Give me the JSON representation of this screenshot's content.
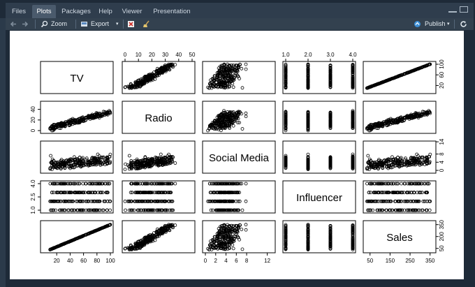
{
  "tabs": [
    {
      "label": "Files",
      "active": false
    },
    {
      "label": "Plots",
      "active": true
    },
    {
      "label": "Packages",
      "active": false
    },
    {
      "label": "Help",
      "active": false
    },
    {
      "label": "Viewer",
      "active": false
    },
    {
      "label": "Presentation",
      "active": false
    }
  ],
  "toolbar": {
    "zoom_label": "Zoom",
    "export_label": "Export",
    "publish_label": "Publish"
  },
  "icons": {
    "back": "back-arrow-icon",
    "forward": "forward-arrow-icon",
    "zoom": "magnifier-icon",
    "export": "export-icon",
    "remove": "remove-plot-icon",
    "clear": "broom-icon",
    "publish": "publish-icon",
    "refresh": "refresh-icon"
  },
  "colors": {
    "frame_bg": "#1e2a38",
    "tab_active": "#4a5a6c",
    "publish_accent": "#3b8ed6"
  },
  "chart_data": {
    "type": "scatter",
    "variables": [
      "TV",
      "Radio",
      "Social Media",
      "Influencer",
      "Sales"
    ],
    "axis_ticks": {
      "TV": [
        "20",
        "40",
        "60",
        "80",
        "100"
      ],
      "Radio": [
        "0",
        "10",
        "20",
        "30",
        "40",
        "50"
      ],
      "Social Media": [
        "0",
        "2",
        "4",
        "6",
        "8",
        "12"
      ],
      "Influencer": [
        "1.0",
        "2.0",
        "3.0",
        "4.0",
        "1.0",
        "2.5",
        "4.0"
      ],
      "Sales": [
        "50",
        "150",
        "250",
        "350",
        "50",
        "200",
        "350"
      ]
    },
    "top_axis_labels": {
      "Radio": [
        "0",
        "10",
        "20",
        "30",
        "40",
        "50"
      ],
      "Influencer": [
        "1.0",
        "2.0",
        "3.0",
        "4.0"
      ]
    },
    "right_axis_labels": {
      "TV": [
        "20",
        "60",
        "100"
      ],
      "Social Media": [
        "0",
        "4",
        "8",
        "14"
      ],
      "Sales": [
        "50",
        "200",
        "350"
      ]
    },
    "left_axis_labels": {
      "Radio": [
        "0",
        "20",
        "40"
      ],
      "Influencer": [
        "1.0",
        "2.5",
        "4.0"
      ]
    },
    "bottom_axis_labels": {
      "TV": [
        "20",
        "40",
        "60",
        "80",
        "100"
      ],
      "Social Media": [
        "0",
        "2",
        "4",
        "6",
        "8",
        "12"
      ],
      "Sales": [
        "50",
        "150",
        "250",
        "350"
      ]
    },
    "xlim": {
      "TV": [
        0,
        100
      ],
      "Radio": [
        0,
        50
      ],
      "Social Media": [
        0,
        13
      ],
      "Influencer": [
        1,
        4
      ],
      "Sales": [
        30,
        365
      ]
    },
    "grid": false,
    "legend": "none"
  }
}
